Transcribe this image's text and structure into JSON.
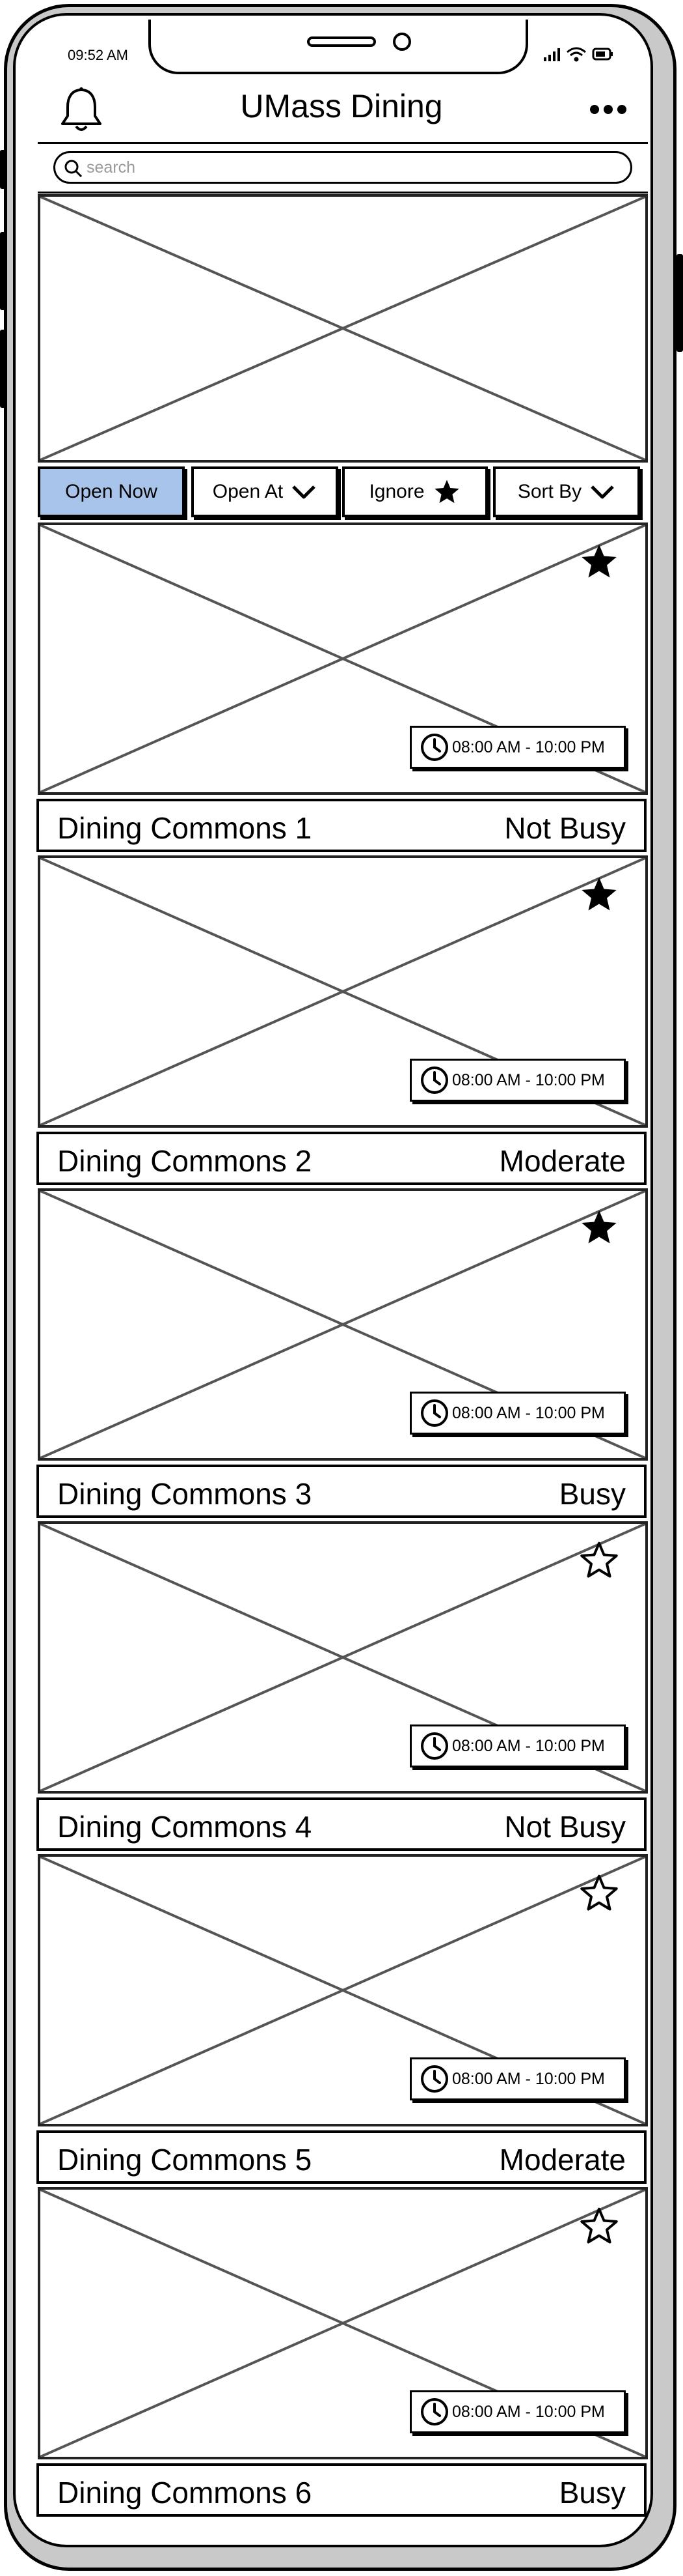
{
  "status_bar": {
    "time": "09:52 AM"
  },
  "header": {
    "title": "UMass Dining"
  },
  "search": {
    "placeholder": "search"
  },
  "filters": {
    "open_now": "Open Now",
    "open_at": "Open At",
    "ignore": "Ignore",
    "sort_by": "Sort By"
  },
  "icons": {
    "bell": "bell-icon",
    "more": "more-icon",
    "search": "search-icon",
    "star_filled": "star-filled-icon",
    "star_outline": "star-outline-icon",
    "clock": "clock-icon",
    "chevron": "chevron-down-icon"
  },
  "colors": {
    "active_filter": "#a9c4eb",
    "outline": "#000000",
    "phone_frame": "#c9c9c9"
  },
  "dining_halls": [
    {
      "name": "Dining Commons 1",
      "busyness": "Not Busy",
      "hours": "08:00 AM - 10:00 PM",
      "favorite": true
    },
    {
      "name": "Dining Commons 2",
      "busyness": "Moderate",
      "hours": "08:00 AM - 10:00 PM",
      "favorite": true
    },
    {
      "name": "Dining Commons 3",
      "busyness": "Busy",
      "hours": "08:00 AM - 10:00 PM",
      "favorite": true
    },
    {
      "name": "Dining Commons 4",
      "busyness": "Not Busy",
      "hours": "08:00 AM - 10:00 PM",
      "favorite": false
    },
    {
      "name": "Dining Commons 5",
      "busyness": "Moderate",
      "hours": "08:00 AM - 10:00 PM",
      "favorite": false
    },
    {
      "name": "Dining Commons 6",
      "busyness": "Busy",
      "hours": "08:00 AM - 10:00 PM",
      "favorite": false
    }
  ]
}
